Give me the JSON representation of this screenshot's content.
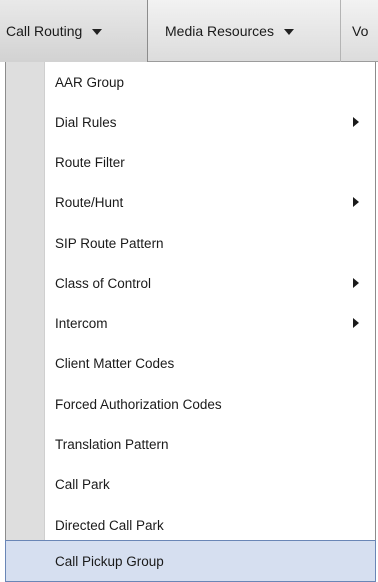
{
  "menubar": {
    "items": [
      {
        "label": "Call Routing",
        "active": true
      },
      {
        "label": "Media Resources",
        "active": false
      },
      {
        "label": "Vo",
        "active": false
      }
    ]
  },
  "dropdown": {
    "items": [
      {
        "label": "AAR Group",
        "submenu": false
      },
      {
        "label": "Dial Rules",
        "submenu": true
      },
      {
        "label": "Route Filter",
        "submenu": false
      },
      {
        "label": "Route/Hunt",
        "submenu": true
      },
      {
        "label": "SIP Route Pattern",
        "submenu": false
      },
      {
        "label": "Class of Control",
        "submenu": true
      },
      {
        "label": "Intercom",
        "submenu": true
      },
      {
        "label": "Client Matter Codes",
        "submenu": false
      },
      {
        "label": "Forced Authorization Codes",
        "submenu": false
      },
      {
        "label": "Translation Pattern",
        "submenu": false
      },
      {
        "label": "Call Park",
        "submenu": false
      },
      {
        "label": "Directed Call Park",
        "submenu": false
      },
      {
        "label": "Call Pickup Group",
        "submenu": false,
        "highlighted": true
      }
    ]
  },
  "colors": {
    "highlight_bg": "#d6dff0",
    "highlight_border": "#6a86b6",
    "gutter": "#dedede"
  }
}
